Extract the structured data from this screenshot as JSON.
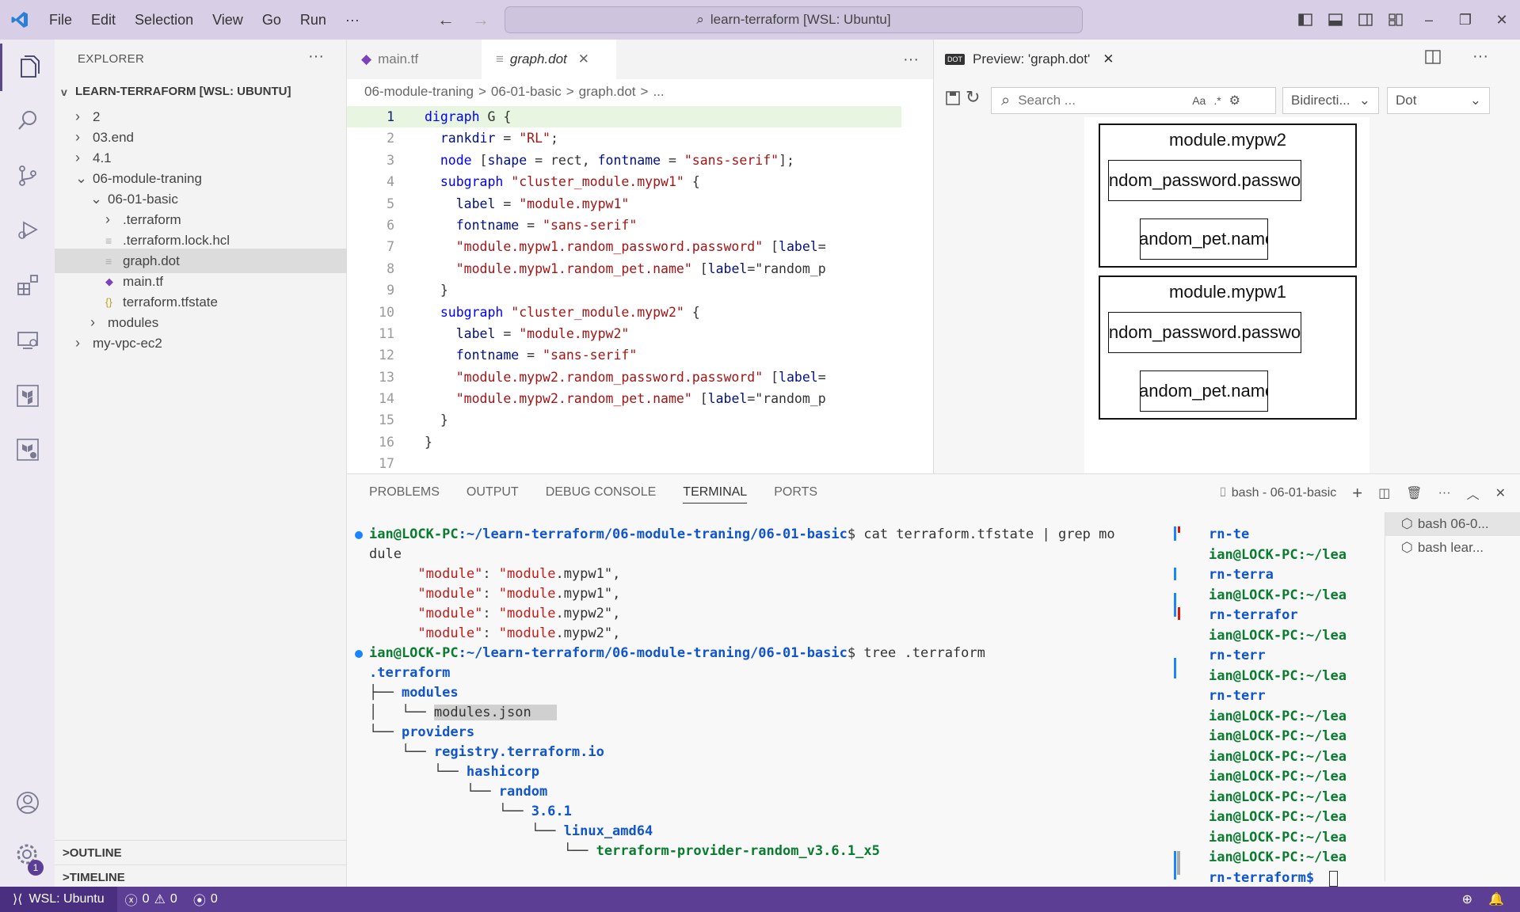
{
  "colors": {
    "titlebar": "#d8cfe6",
    "statusbar": "#5c3e95",
    "accent": "#5c3e95",
    "terraform": "#7b42bc"
  },
  "titlebar": {
    "menu": [
      "File",
      "Edit",
      "Selection",
      "View",
      "Go",
      "Run",
      "···"
    ],
    "search": "learn-terraform [WSL: Ubuntu]"
  },
  "activity": {
    "settings_badge": "1"
  },
  "explorer": {
    "title": "EXPLORER",
    "root": "LEARN-TERRAFORM [WSL: UBUNTU]",
    "items": [
      {
        "label": "2",
        "twisty": ">"
      },
      {
        "label": "03.end",
        "twisty": ">"
      },
      {
        "label": "4.1",
        "twisty": ">"
      },
      {
        "label": "06-module-traning",
        "twisty": "v"
      },
      {
        "label": "06-01-basic",
        "twisty": "v"
      },
      {
        "label": ".terraform",
        "twisty": ">"
      },
      {
        "label": ".terraform.lock.hcl",
        "icon": "≡"
      },
      {
        "label": "graph.dot",
        "icon": "≡"
      },
      {
        "label": "main.tf",
        "icon": "terraform-icon"
      },
      {
        "label": "terraform.tfstate",
        "icon": "{}"
      },
      {
        "label": "modules",
        "twisty": ">"
      },
      {
        "label": "my-vpc-ec2",
        "twisty": ">"
      }
    ],
    "outline": "OUTLINE",
    "timeline": "TIMELINE"
  },
  "editor": {
    "tabs": [
      {
        "label": "main.tf"
      },
      {
        "label": "graph.dot"
      }
    ],
    "breadcrumb": [
      "06-module-traning",
      ">",
      "06-01-basic",
      ">",
      "graph.dot",
      ">",
      "..."
    ],
    "lines": [
      "1",
      "2",
      "3",
      "4",
      "5",
      "6",
      "7",
      "8",
      "9",
      "10",
      "11",
      "12",
      "13",
      "14",
      "15",
      "16",
      "17"
    ],
    "code": [
      "digraph G {",
      "  rankdir = \"RL\";",
      "  node [shape = rect, fontname = \"sans-serif\"];",
      "  subgraph \"cluster_module.mypw1\" {",
      "    label = \"module.mypw1\"",
      "    fontname = \"sans-serif\"",
      "    \"module.mypw1.random_password.password\" [label=",
      "    \"module.mypw1.random_pet.name\" [label=\"random_p",
      "  }",
      "  subgraph \"cluster_module.mypw2\" {",
      "    label = \"module.mypw2\"",
      "    fontname = \"sans-serif\"",
      "    \"module.mypw2.random_password.password\" [label=",
      "    \"module.mypw2.random_pet.name\" [label=\"random_p",
      "  }",
      "}",
      ""
    ]
  },
  "preview": {
    "tab": "Preview: 'graph.dot'",
    "search_placeholder": "Search ...",
    "search_opt": "Aa",
    "direction": "Bidirecti...",
    "engine": "Dot",
    "clusters": [
      {
        "label": "module.mypw2",
        "password": "random_password.password",
        "pet": "random_pet.name"
      },
      {
        "label": "module.mypw1",
        "password": "random_password.password",
        "pet": "random_pet.name"
      }
    ]
  },
  "panel": {
    "tabs": [
      "PROBLEMS",
      "OUTPUT",
      "DEBUG CONSOLE",
      "TERMINAL",
      "PORTS"
    ],
    "terminal_name": "bash - 06-01-basic",
    "prompt_user": "ian@LOCK-PC",
    "prompt_path": ":~/learn-terraform/06-module-traning/06-01-basic",
    "cmd1": "$ cat terraform.tfstate | grep mo",
    "cmd1_wrap": "dule",
    "grep_key": "\"module\"",
    "grep_values": [
      "\"module.mypw1\",",
      "\"module.mypw1\",",
      "\"module.mypw2\",",
      "\"module.mypw2\","
    ],
    "cmd2": "$ tree .terraform",
    "tree": [
      {
        "prefix": "",
        "text": ".terraform",
        "cls": "tb"
      },
      {
        "prefix": "├── ",
        "text": "modules",
        "cls": "tb"
      },
      {
        "prefix": "│   └── ",
        "text": "modules.json",
        "cls": "tw2"
      },
      {
        "prefix": "└── ",
        "text": "providers",
        "cls": "tb"
      },
      {
        "prefix": "    └── ",
        "text": "registry.terraform.io",
        "cls": "tb"
      },
      {
        "prefix": "        └── ",
        "text": "hashicorp",
        "cls": "tb"
      },
      {
        "prefix": "            └── ",
        "text": "random",
        "cls": "tb"
      },
      {
        "prefix": "                └── ",
        "text": "3.6.1",
        "cls": "tb"
      },
      {
        "prefix": "                    └── ",
        "text": "linux_amd64",
        "cls": "tb"
      },
      {
        "prefix": "                        └── ",
        "text": "terraform-provider-random_v3.6.1_x5",
        "cls": "tg"
      }
    ],
    "term2": [
      {
        "t": "rn-te",
        "c": "tb"
      },
      {
        "t": "ian@LOCK-PC:~/lea",
        "c": "tg"
      },
      {
        "t": "rn-terra",
        "c": "tb"
      },
      {
        "t": "ian@LOCK-PC:~/lea",
        "c": "tg"
      },
      {
        "t": "rn-terrafor",
        "c": "tb"
      },
      {
        "t": "ian@LOCK-PC:~/lea",
        "c": "tg"
      },
      {
        "t": "rn-terr",
        "c": "tb"
      },
      {
        "t": "ian@LOCK-PC:~/lea",
        "c": "tg"
      },
      {
        "t": "rn-terr",
        "c": "tb"
      },
      {
        "t": "ian@LOCK-PC:~/lea",
        "c": "tg"
      },
      {
        "t": "ian@LOCK-PC:~/lea",
        "c": "tg"
      },
      {
        "t": "ian@LOCK-PC:~/lea",
        "c": "tg"
      },
      {
        "t": "ian@LOCK-PC:~/lea",
        "c": "tg"
      },
      {
        "t": "ian@LOCK-PC:~/lea",
        "c": "tg"
      },
      {
        "t": "ian@LOCK-PC:~/lea",
        "c": "tg"
      },
      {
        "t": "ian@LOCK-PC:~/lea",
        "c": "tg"
      },
      {
        "t": "ian@LOCK-PC:~/lea",
        "c": "tg"
      },
      {
        "t": "rn-terraform$",
        "c": "tb"
      }
    ],
    "term_list": [
      "bash 06-0...",
      "bash lear..."
    ]
  },
  "status": {
    "remote": "WSL: Ubuntu",
    "errors": "0",
    "warnings": "0",
    "ports": "0"
  }
}
